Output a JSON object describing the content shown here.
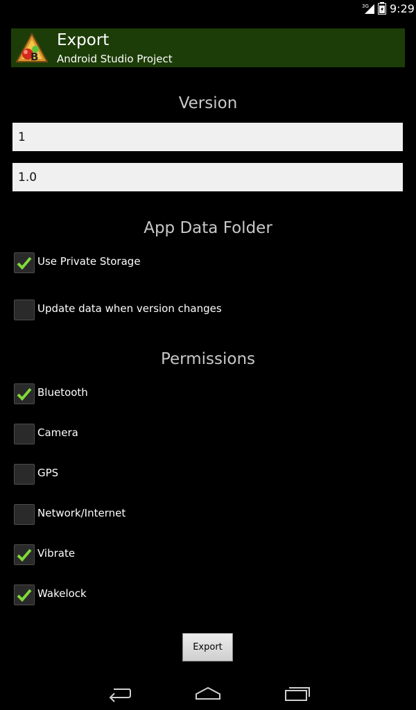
{
  "status_bar": {
    "network": "3G",
    "time": "9:29"
  },
  "header": {
    "title": "Export",
    "subtitle": "Android Studio Project",
    "logo_letter": "B",
    "bg_color": "#1d3d08"
  },
  "version": {
    "title": "Version",
    "version_code": "1",
    "version_name": "1.0"
  },
  "app_data_folder": {
    "title": "App Data Folder",
    "options": [
      {
        "label": "Use Private Storage",
        "checked": true
      },
      {
        "label": "Update data when version changes",
        "checked": false
      }
    ]
  },
  "permissions": {
    "title": "Permissions",
    "options": [
      {
        "label": "Bluetooth",
        "checked": true
      },
      {
        "label": "Camera",
        "checked": false
      },
      {
        "label": "GPS",
        "checked": false
      },
      {
        "label": "Network/Internet",
        "checked": false
      },
      {
        "label": "Vibrate",
        "checked": true
      },
      {
        "label": "Wakelock",
        "checked": true
      }
    ]
  },
  "export_button": {
    "label": "Export"
  },
  "colors": {
    "check": "#7fd93a",
    "section_title": "#c8c8c8"
  }
}
